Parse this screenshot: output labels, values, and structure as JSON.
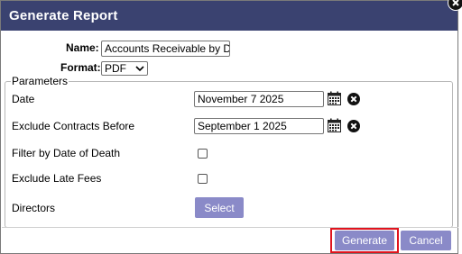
{
  "dialog": {
    "title": "Generate Report",
    "close_icon": "close-x-icon"
  },
  "form": {
    "name_label": "Name:",
    "name_value": "Accounts Receivable by Dir",
    "format_label": "Format:",
    "format_value": "PDF"
  },
  "parameters": {
    "legend": "Parameters",
    "date_label": "Date",
    "date_value": "November 7 2025",
    "exclude_before_label": "Exclude Contracts Before",
    "exclude_before_value": "September 1 2025",
    "filter_dod_label": "Filter by Date of Death",
    "filter_dod_checked": false,
    "exclude_late_fees_label": "Exclude Late Fees",
    "exclude_late_fees_checked": false,
    "directors_label": "Directors",
    "select_button": "Select",
    "calendar_icon": "calendar-icon",
    "clear_icon": "clear-x-icon"
  },
  "footer": {
    "generate_button": "Generate",
    "cancel_button": "Cancel"
  },
  "colors": {
    "titlebar": "#3a4270",
    "button": "#8a8ac8",
    "highlight": "#e0141e"
  }
}
